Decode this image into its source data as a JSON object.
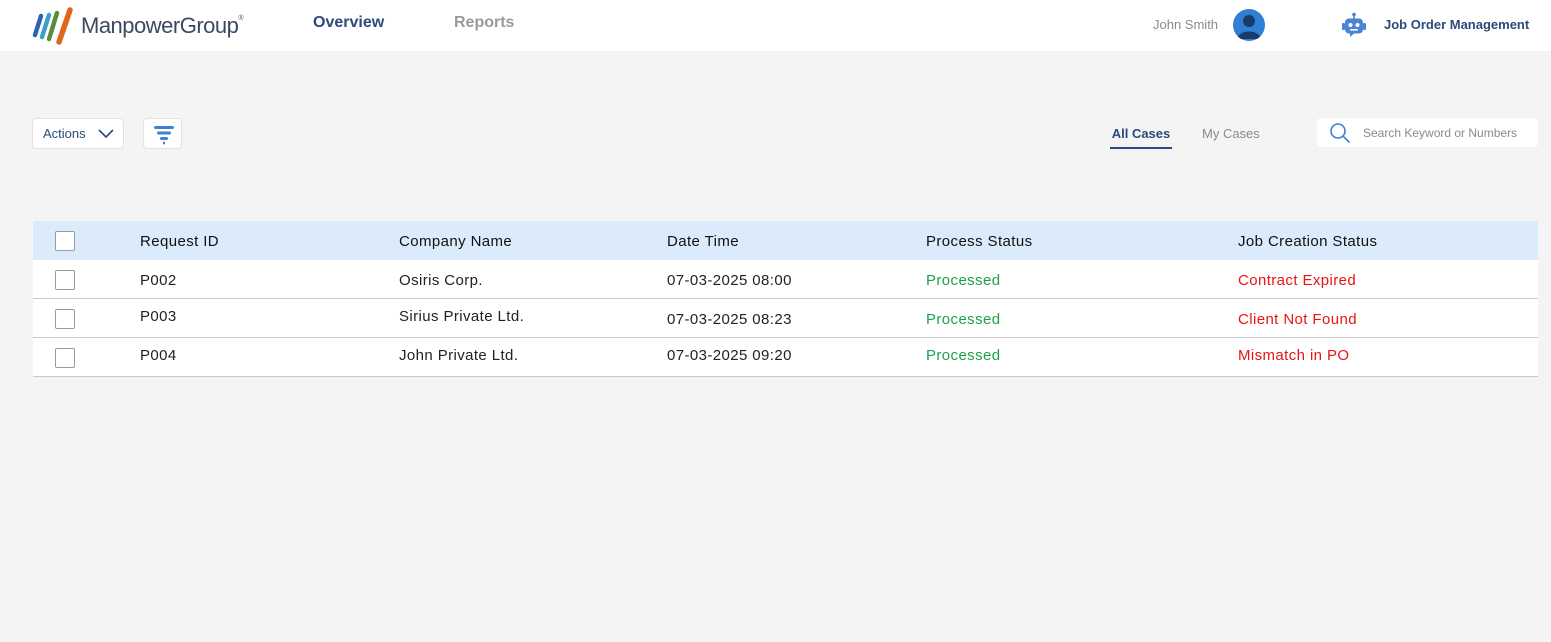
{
  "brand": {
    "name": "ManpowerGroup",
    "trademark": "®"
  },
  "nav": {
    "overview": "Overview",
    "reports": "Reports"
  },
  "user": {
    "name": "John Smith"
  },
  "app_title": "Job Order Management",
  "toolbar": {
    "actions_label": "Actions"
  },
  "tabs": {
    "all_cases": "All Cases",
    "my_cases": "My Cases"
  },
  "search": {
    "placeholder": "Search Keyword or Numbers"
  },
  "table": {
    "headers": [
      "Request ID",
      "Company Name",
      "Date Time",
      "Process Status",
      "Job Creation Status"
    ],
    "rows": [
      {
        "request_id": "P002",
        "company": "Osiris Corp.",
        "datetime": "07-03-2025 08:00",
        "process_status": "Processed",
        "job_status": "Contract Expired"
      },
      {
        "request_id": "P003",
        "company": "Sirius Private Ltd.",
        "datetime": "07-03-2025 08:23",
        "process_status": "Processed",
        "job_status": "Client Not Found"
      },
      {
        "request_id": "P004",
        "company": "John Private Ltd.",
        "datetime": "07-03-2025 09:20",
        "process_status": "Processed",
        "job_status": "Mismatch in PO"
      }
    ]
  },
  "colors": {
    "brand_navy": "#2c4a7a",
    "header_row_bg": "#dcebfb",
    "processed": "#1ca24a",
    "error": "#e81414",
    "avatar": "#2f7fd4"
  },
  "icons": {
    "logo": "manpower-logo-icon",
    "avatar": "user-avatar-icon",
    "bot": "robot-icon",
    "dropdown": "chevron-down-icon",
    "filter": "filter-icon",
    "search": "search-icon"
  }
}
